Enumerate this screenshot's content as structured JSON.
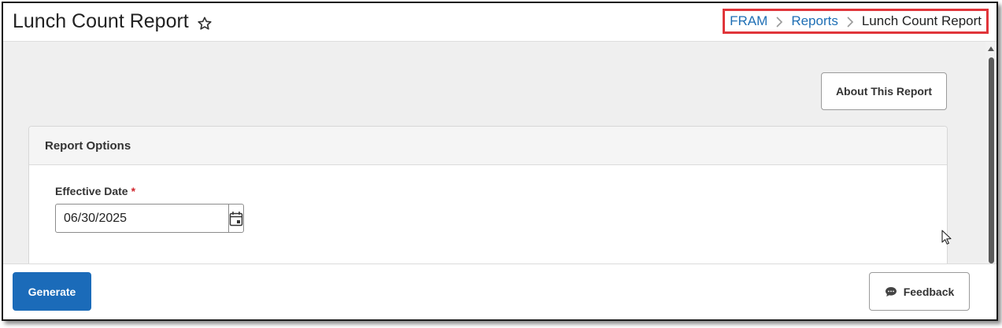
{
  "header": {
    "title": "Lunch Count Report",
    "favorite_icon": "star-outline-icon",
    "breadcrumb": {
      "items": [
        "FRAM",
        "Reports",
        "Lunch Count Report"
      ],
      "highlight_color": "#e0353a"
    }
  },
  "main": {
    "about_button_label": "About This Report",
    "report_options": {
      "title": "Report Options",
      "effective_date": {
        "label": "Effective Date",
        "required_marker": "*",
        "value": "06/30/2025",
        "icon": "calendar-icon"
      }
    }
  },
  "footer": {
    "generate_label": "Generate",
    "feedback_label": "Feedback",
    "feedback_icon": "chat-bubble-icon"
  },
  "colors": {
    "primary": "#1b6bb9",
    "link": "#1f6fb5",
    "required": "#d0262d"
  }
}
